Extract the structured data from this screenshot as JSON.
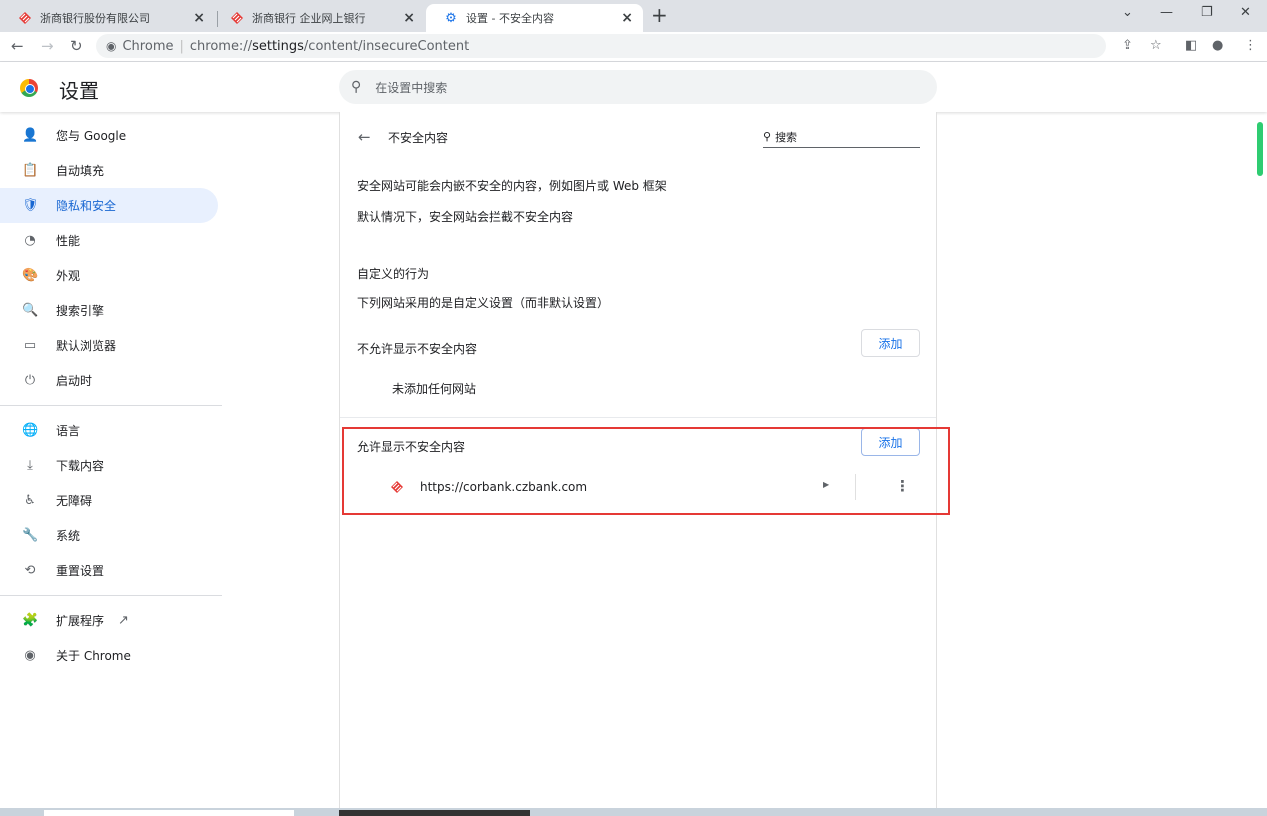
{
  "tabs": [
    {
      "title": "浙商银行股份有限公司",
      "active": false
    },
    {
      "title": "浙商银行 企业网上银行",
      "active": false
    },
    {
      "title": "设置 - 不安全内容",
      "active": true
    }
  ],
  "address": {
    "site": "Chrome",
    "url_prefix": "chrome://",
    "url_host": "settings",
    "url_path": "/content/insecureContent"
  },
  "header": {
    "title": "设置",
    "search_placeholder": "在设置中搜索"
  },
  "sidebar": {
    "group1": [
      {
        "label": "您与 Google",
        "icon": "person-icon",
        "glyph": "👤"
      },
      {
        "label": "自动填充",
        "icon": "clipboard-icon",
        "glyph": "📋"
      },
      {
        "label": "隐私和安全",
        "icon": "shield-icon",
        "glyph": "🛡",
        "active": true
      },
      {
        "label": "性能",
        "icon": "speedometer-icon",
        "glyph": "◔"
      },
      {
        "label": "外观",
        "icon": "palette-icon",
        "glyph": "🎨"
      },
      {
        "label": "搜索引擎",
        "icon": "search-icon",
        "glyph": "🔍"
      },
      {
        "label": "默认浏览器",
        "icon": "browser-icon",
        "glyph": "▭"
      },
      {
        "label": "启动时",
        "icon": "power-icon",
        "glyph": "⏻"
      }
    ],
    "group2": [
      {
        "label": "语言",
        "icon": "globe-icon",
        "glyph": "🌐"
      },
      {
        "label": "下载内容",
        "icon": "download-icon",
        "glyph": "⤓"
      },
      {
        "label": "无障碍",
        "icon": "accessibility-icon",
        "glyph": "♿"
      },
      {
        "label": "系统",
        "icon": "wrench-icon",
        "glyph": "🔧"
      },
      {
        "label": "重置设置",
        "icon": "reset-icon",
        "glyph": "⟲"
      }
    ],
    "group3": [
      {
        "label": "扩展程序",
        "icon": "puzzle-icon",
        "glyph": "🧩",
        "external": "↗"
      },
      {
        "label": "关于 Chrome",
        "icon": "chrome-icon",
        "glyph": "◉"
      }
    ]
  },
  "content": {
    "title": "不安全内容",
    "search_label": "搜索",
    "description": "安全网站可能会内嵌不安全的内容，例如图片或 Web 框架",
    "default_behavior": "默认情况下，安全网站会拦截不安全内容",
    "custom_heading": "自定义的行为",
    "custom_subtitle": "下列网站采用的是自定义设置（而非默认设置）",
    "block_section": {
      "label": "不允许显示不安全内容",
      "add_label": "添加",
      "empty_text": "未添加任何网站"
    },
    "allow_section": {
      "label": "允许显示不安全内容",
      "add_label": "添加",
      "sites": [
        "https://corbank.czbank.com"
      ]
    }
  },
  "colors": {
    "accent": "#1a73e8",
    "active_bg": "#e8f0fe",
    "highlight_border": "#e53935",
    "czbank_red": "#e53935"
  }
}
